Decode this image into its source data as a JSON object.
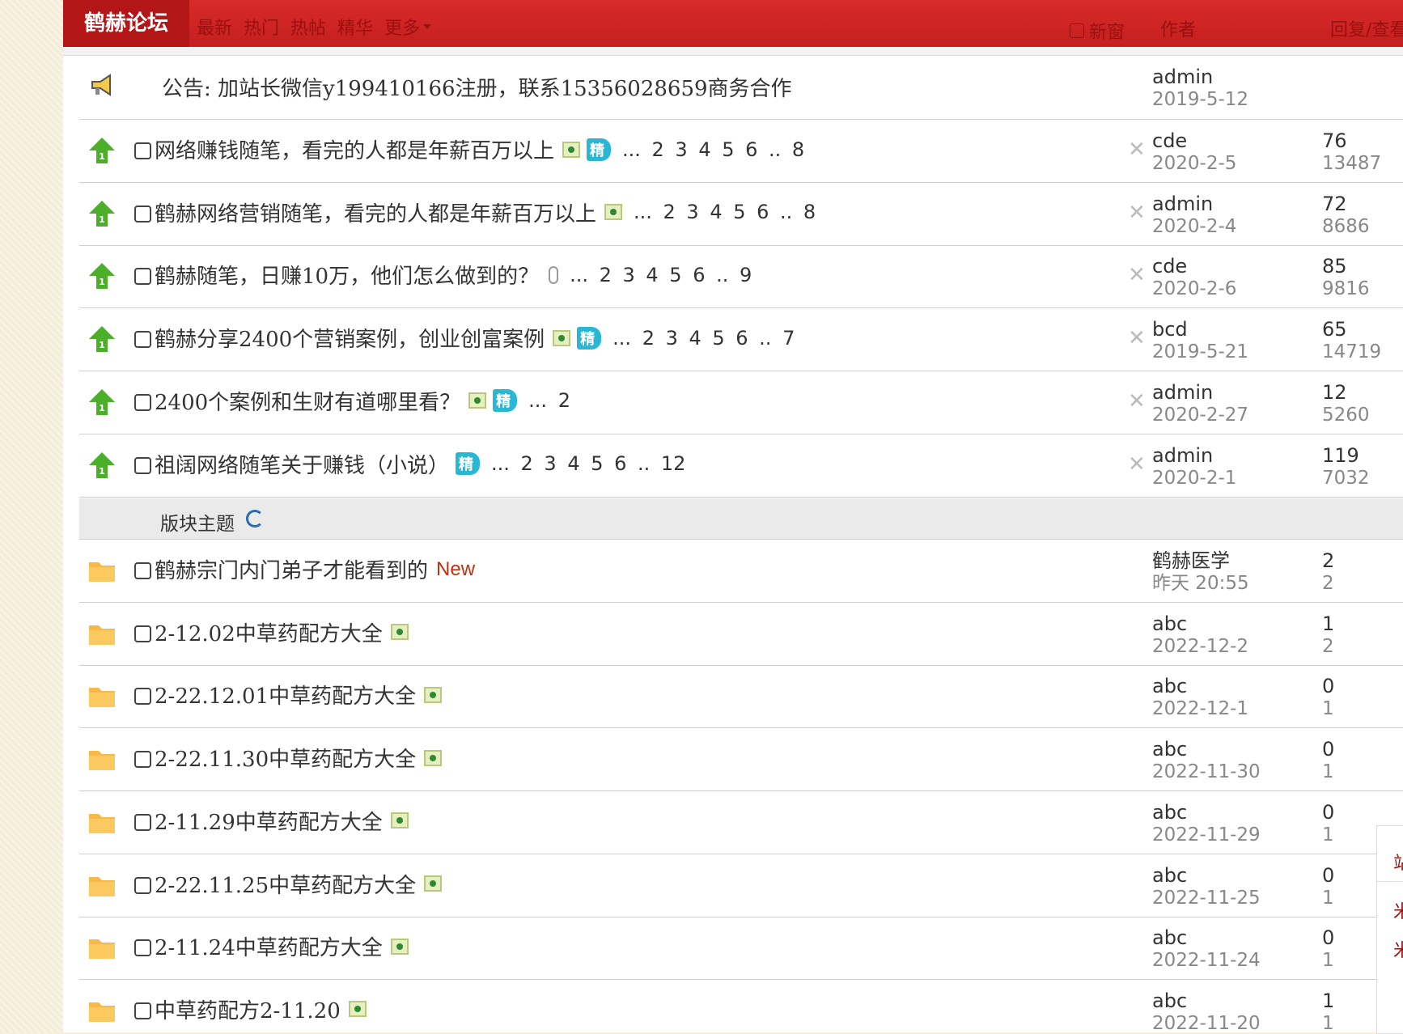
{
  "header": {
    "forum_title": "鹤赫论坛",
    "nav": [
      "最新",
      "热门",
      "热帖",
      "精华",
      "更多"
    ],
    "new_window_label": "新窗",
    "col_author": "作者",
    "col_reply": "回复/查看"
  },
  "announcement": {
    "text": "公告: 加站长微信y199410166注册，联系15356028659商务合作",
    "author": "admin",
    "date": "2019-5-12"
  },
  "pinned": [
    {
      "title": "网络赚钱随笔，看完的人都是年薪百万以上",
      "img": true,
      "jing": true,
      "attach": false,
      "pages": "... 2  3  4  5  6 .. 8",
      "author": "cde",
      "date": "2020-2-5",
      "replies": "76",
      "views": "13487"
    },
    {
      "title": "鹤赫网络营销随笔，看完的人都是年薪百万以上",
      "img": true,
      "jing": false,
      "attach": false,
      "pages": "... 2  3  4  5  6 .. 8",
      "author": "admin",
      "date": "2020-2-4",
      "replies": "72",
      "views": "8686"
    },
    {
      "title": "鹤赫随笔，日赚10万，他们怎么做到的？",
      "img": false,
      "jing": false,
      "attach": true,
      "pages": "... 2  3  4  5  6 .. 9",
      "author": "cde",
      "date": "2020-2-6",
      "replies": "85",
      "views": "9816"
    },
    {
      "title": "鹤赫分享2400个营销案例，创业创富案例",
      "img": true,
      "jing": true,
      "attach": false,
      "pages": "... 2  3  4  5  6 .. 7",
      "author": "bcd",
      "date": "2019-5-21",
      "replies": "65",
      "views": "14719"
    },
    {
      "title": "2400个案例和生财有道哪里看？",
      "img": true,
      "jing": true,
      "attach": false,
      "pages": "... 2",
      "author": "admin",
      "date": "2020-2-27",
      "replies": "12",
      "views": "5260"
    },
    {
      "title": "祖阔网络随笔关于赚钱（小说）",
      "img": false,
      "jing": true,
      "attach": false,
      "pages": "... 2  3  4  5  6 .. 12",
      "author": "admin",
      "date": "2020-2-1",
      "replies": "119",
      "views": "7032"
    }
  ],
  "section_label": "版块主题",
  "jing_label": "精",
  "new_label": "New",
  "threads": [
    {
      "title": "鹤赫宗门内门弟子才能看到的",
      "img": false,
      "new": true,
      "author": "鹤赫医学",
      "date": "昨天 20:55",
      "replies": "2",
      "views": "2"
    },
    {
      "title": "2-12.02中草药配方大全",
      "img": true,
      "new": false,
      "author": "abc",
      "date": "2022-12-2",
      "replies": "1",
      "views": "2"
    },
    {
      "title": "2-22.12.01中草药配方大全",
      "img": true,
      "new": false,
      "author": "abc",
      "date": "2022-12-1",
      "replies": "0",
      "views": "1"
    },
    {
      "title": "2-22.11.30中草药配方大全",
      "img": true,
      "new": false,
      "author": "abc",
      "date": "2022-11-30",
      "replies": "0",
      "views": "1"
    },
    {
      "title": "2-11.29中草药配方大全",
      "img": true,
      "new": false,
      "author": "abc",
      "date": "2022-11-29",
      "replies": "0",
      "views": "1"
    },
    {
      "title": "2-22.11.25中草药配方大全",
      "img": true,
      "new": false,
      "author": "abc",
      "date": "2022-11-25",
      "replies": "0",
      "views": "1"
    },
    {
      "title": "2-11.24中草药配方大全",
      "img": true,
      "new": false,
      "author": "abc",
      "date": "2022-11-24",
      "replies": "0",
      "views": "1"
    },
    {
      "title": "中草药配方2-11.20",
      "img": true,
      "new": false,
      "author": "abc",
      "date": "2022-11-20",
      "replies": "1",
      "views": "1"
    }
  ],
  "float_panel": {
    "chars": [
      "站",
      "米",
      "米"
    ]
  },
  "colors": {
    "header_red": "#c41f1f",
    "accent_link": "#9a1010",
    "jing_tag": "#2ab7d3",
    "new_tag": "#c03010",
    "pin_arrow": "#4caf2a",
    "folder": "#f6b94a"
  }
}
